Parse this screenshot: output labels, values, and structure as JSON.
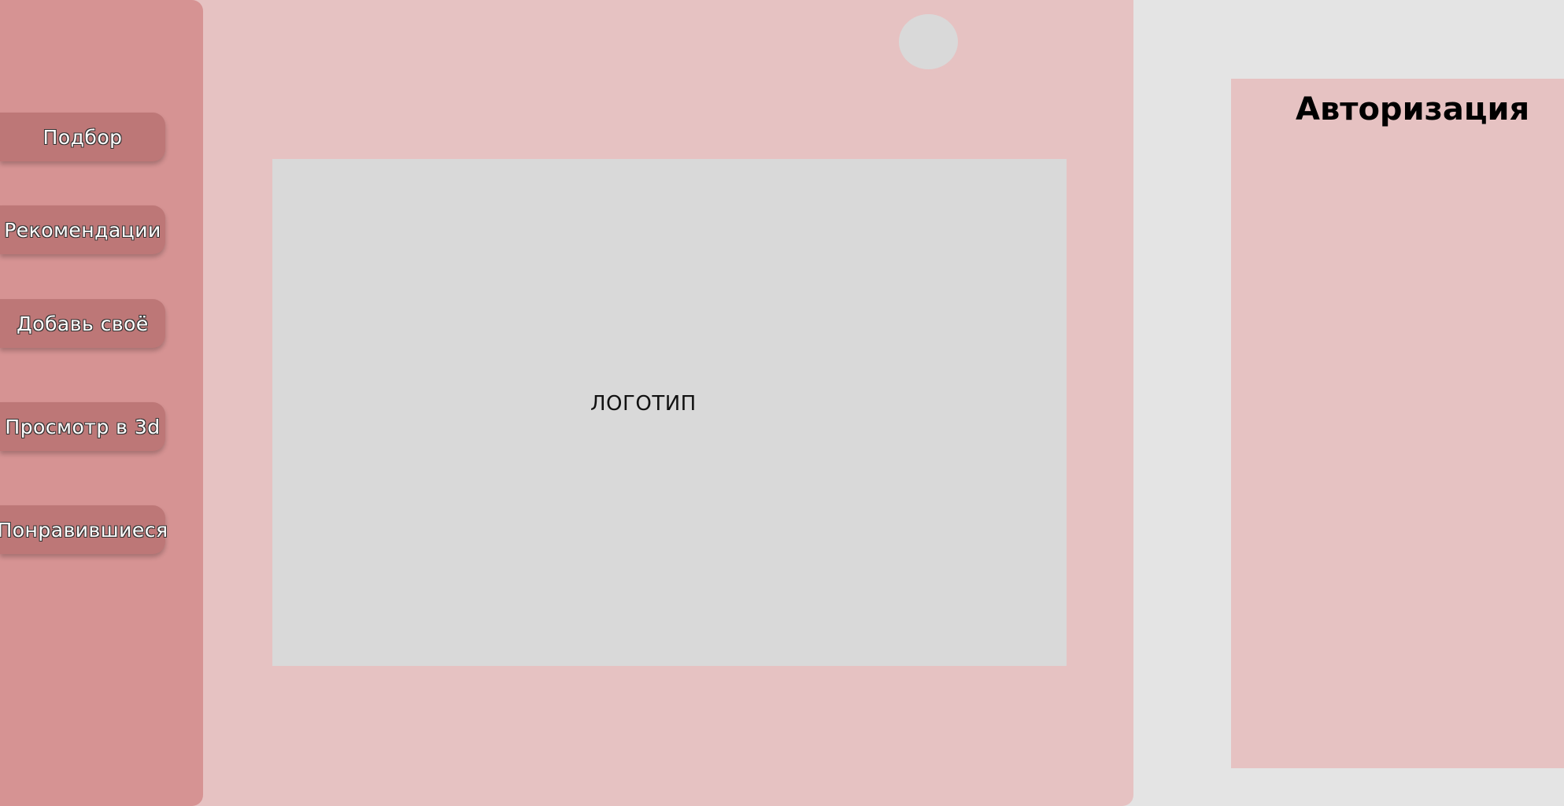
{
  "colors": {
    "page_background": "#e4e4e4",
    "main_background": "#e6c2c2",
    "sidebar_background": "#d69393",
    "nav_button": "#bd7777",
    "placeholder_gray": "#d9d9d9",
    "auth_panel": "#e6c2c2"
  },
  "sidebar": {
    "items": [
      {
        "label": "Подбор"
      },
      {
        "label": "Рекомендации"
      },
      {
        "label": "Добавь своё"
      },
      {
        "label": "Просмотр в 3d"
      },
      {
        "label": "Понравившиеся"
      }
    ]
  },
  "main": {
    "logo_label": "ЛОГОТИП"
  },
  "auth": {
    "title": "Авторизация"
  }
}
